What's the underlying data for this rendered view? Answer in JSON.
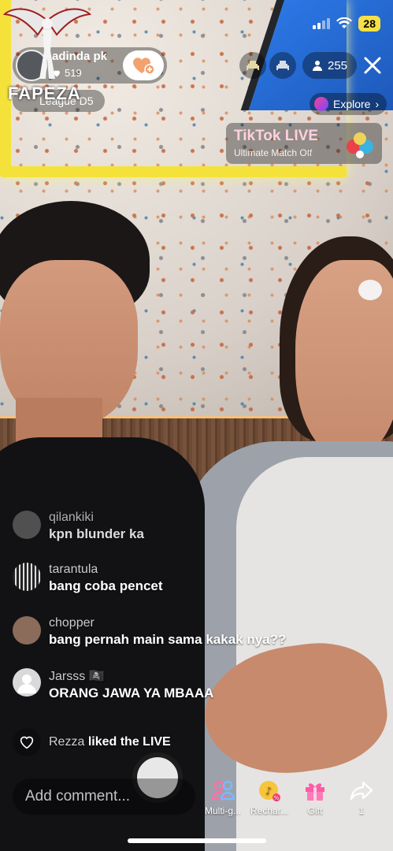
{
  "status_bar": {
    "battery": "28"
  },
  "watermark": {
    "text": "FAPEZA"
  },
  "host": {
    "name": "adinda pk",
    "likes": "519",
    "league": "League D5"
  },
  "top_right": {
    "viewer_count": "255",
    "explore_label": "Explore",
    "promo_title": "TikTok LIVE",
    "promo_subtitle": "Ultimate Match Off"
  },
  "comments": [
    {
      "user": "qilankiki",
      "text": "kpn blunder ka"
    },
    {
      "user": "tarantula",
      "text": "bang coba pencet"
    },
    {
      "user": "chopper",
      "text": "bang pernah main sama kakak nya??"
    },
    {
      "user": "Jarsss",
      "text": "ORANG JAWA YA MBAAA"
    }
  ],
  "liked_event": {
    "user": "Rezza",
    "text": "liked the LIVE"
  },
  "bottom_bar": {
    "comment_placeholder": "Add comment...",
    "actions": [
      {
        "label": "Multi-g...",
        "icon": "multi-guest-icon"
      },
      {
        "label": "Rechar...",
        "icon": "recharge-icon"
      },
      {
        "label": "Gift",
        "icon": "gift-icon"
      },
      {
        "label": "1",
        "icon": "share-icon"
      }
    ]
  },
  "colors": {
    "battery": "#f6e045",
    "accent_pink": "#ff3e9a",
    "overlay": "rgba(0,0,0,0.35)"
  }
}
